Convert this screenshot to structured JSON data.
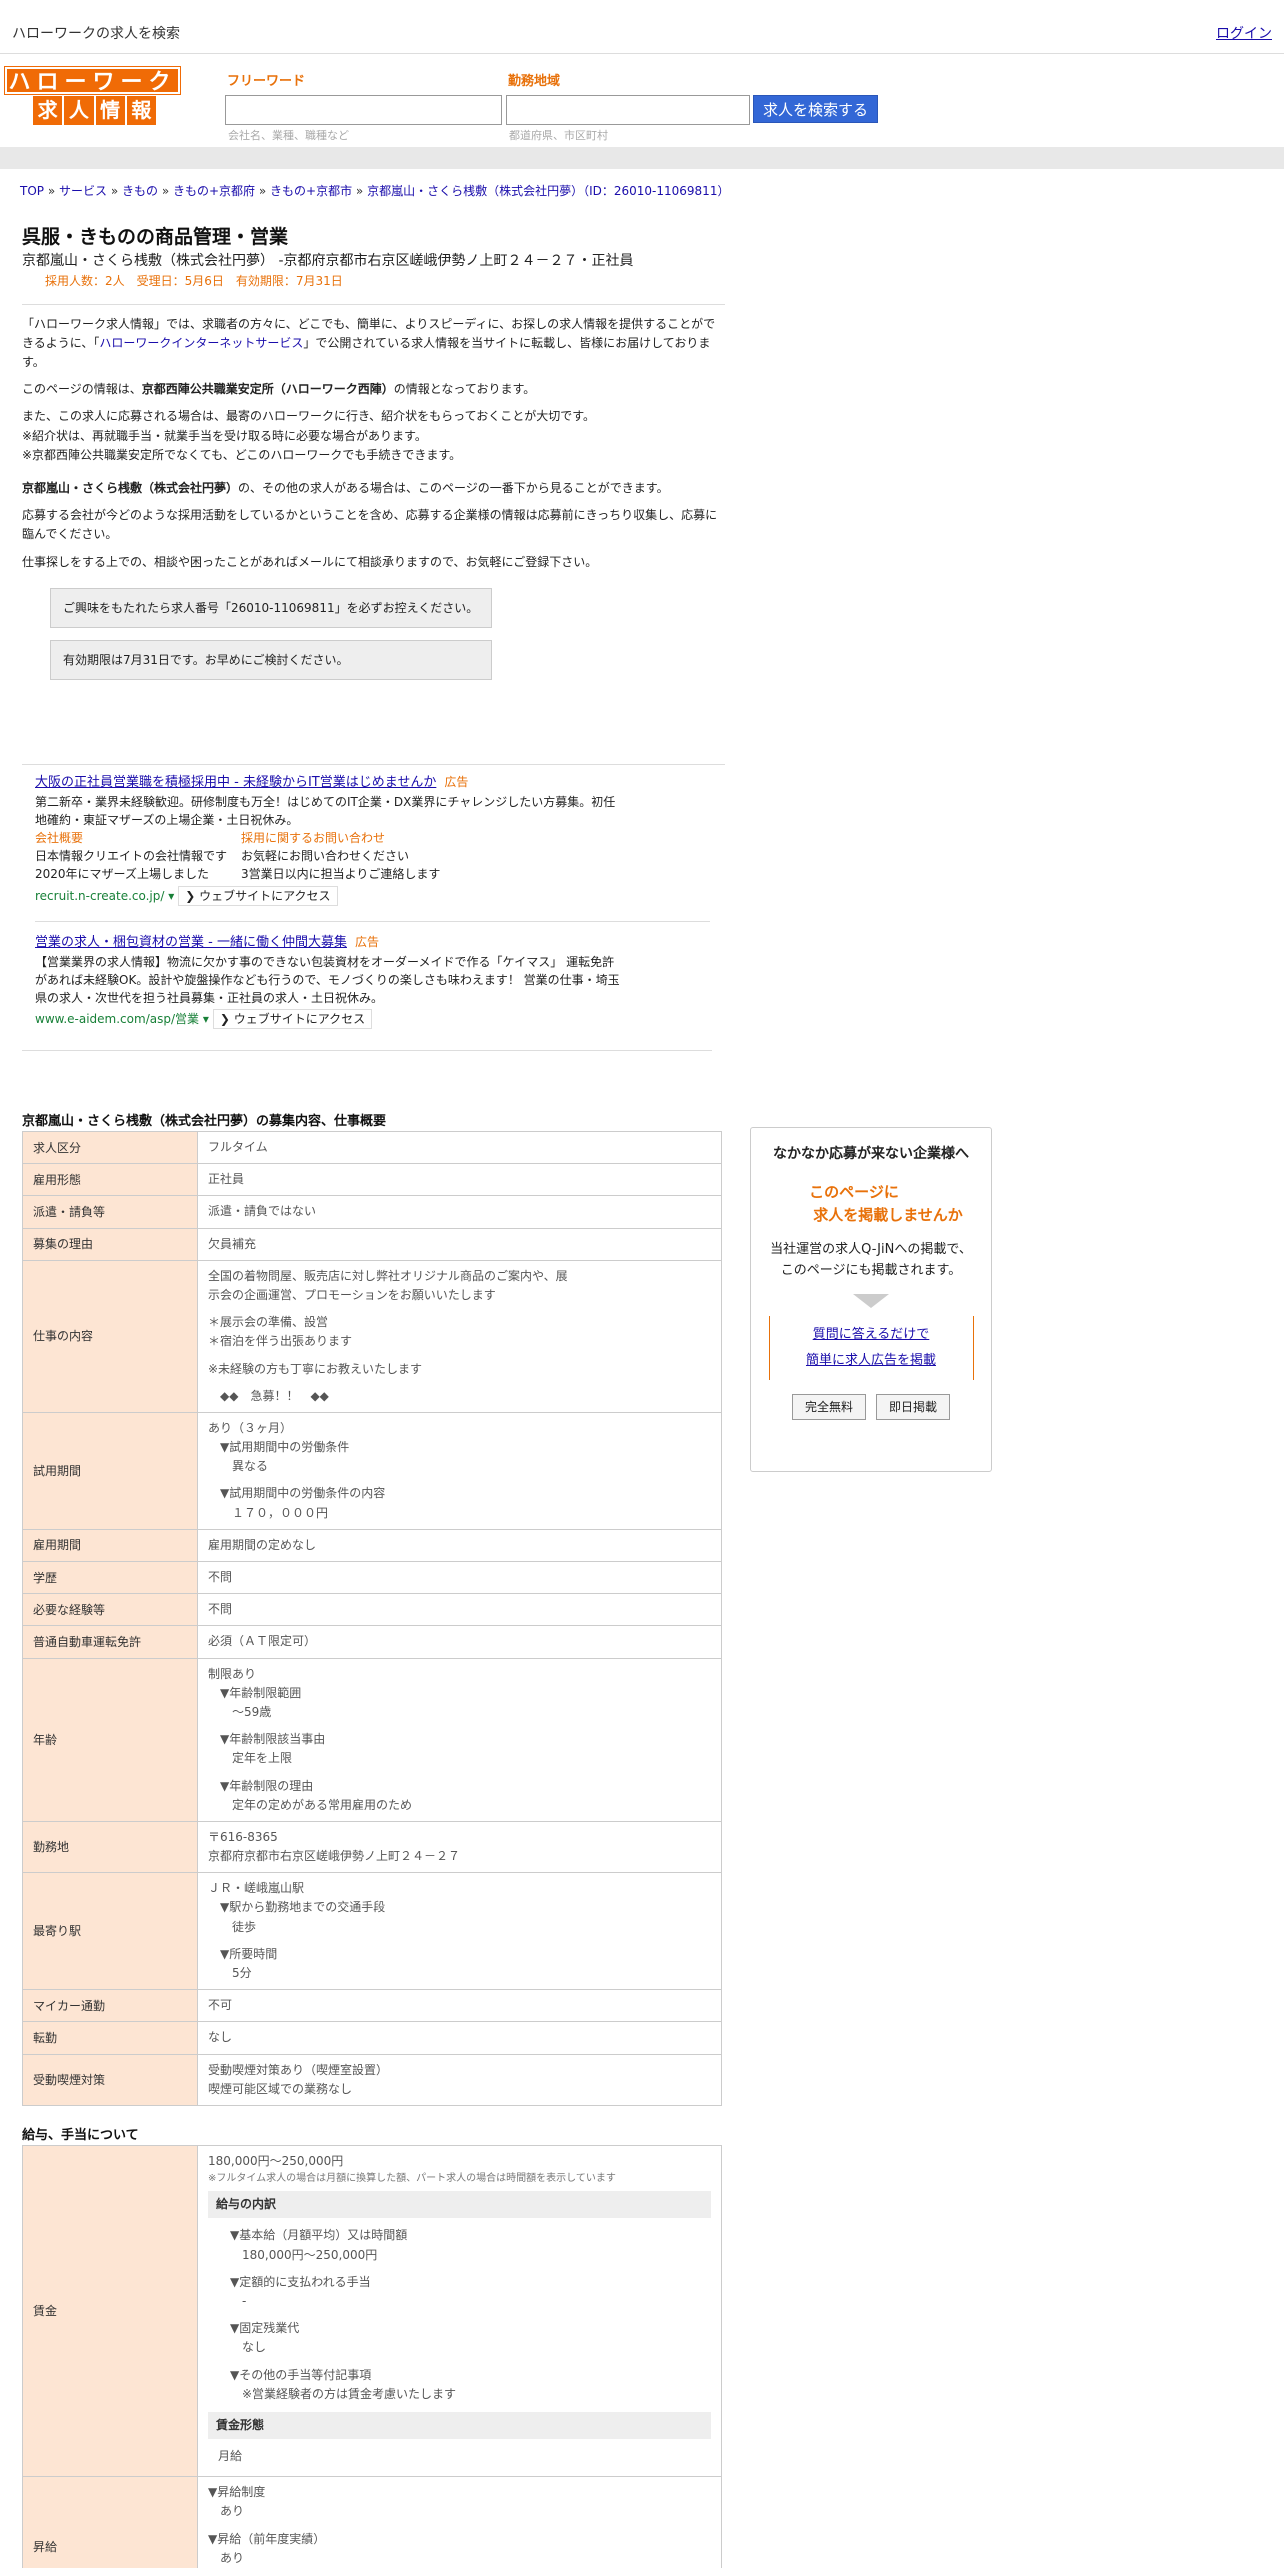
{
  "topbar": {
    "title": "ハローワークの求人を検索",
    "login": "ログイン"
  },
  "logo": {
    "row1": "ハローワーク",
    "row2": [
      "求",
      "人",
      "情",
      "報"
    ]
  },
  "search": {
    "free_label": "フリーワード",
    "free_hint": "会社名、業種、職種など",
    "area_label": "勤務地域",
    "area_hint": "都道府県、市区町村",
    "button": "求人を検索する"
  },
  "breadcrumb": [
    "TOP",
    "サービス",
    "きもの",
    "きもの+京都府",
    "きもの+京都市",
    "京都嵐山・さくら桟敷（株式会社円夢）（ID：26010-11069811）"
  ],
  "job": {
    "title": "呉服・きものの商品管理・営業",
    "subtitle": "京都嵐山・さくら桟敷（株式会社円夢） -京都府京都市右京区嵯峨伊勢ノ上町２４－２７・正社員",
    "meta": "採用人数：2人　受理日：5月6日　有効期限：7月31日"
  },
  "intro": {
    "p1a": "「ハローワーク求人情報」では、求職者の方々に、どこでも、簡単に、よりスピーディに、お探しの求人情報を提供することができるように、「",
    "p1link": "ハローワークインターネットサービス",
    "p1b": "」で公開されている求人情報を当サイトに転載し、皆様にお届けしております。",
    "p2a": "このページの情報は、",
    "p2b": "京都西陣公共職業安定所（ハローワーク西陣）",
    "p2c": "の情報となっております。",
    "p3": "また、この求人に応募される場合は、最寄のハローワークに行き、紹介状をもらっておくことが大切です。",
    "p4": "※紹介状は、再就職手当・就業手当を受け取る時に必要な場合があります。",
    "p5": "※京都西陣公共職業安定所でなくても、どこのハローワークでも手続きできます。",
    "p6a": "京都嵐山・さくら桟敷（株式会社円夢）",
    "p6b": "の、その他の求人がある場合は、このページの一番下から見ることができます。",
    "p7": "応募する会社が今どのような採用活動をしているかということを含め、応募する企業様の情報は応募前にきっちり収集し、応募に臨んでください。",
    "p8": "仕事探しをする上での、相談や困ったことがあればメールにて相談承りますので、お気軽にご登録下さい。",
    "note1": "ご興味をもたれたら求人番号「26010-11069811」を必ずお控えください。",
    "note2": "有効期限は7月31日です。お早めにご検討ください。"
  },
  "ads": [
    {
      "title": "大阪の正社員営業職を積極採用中 - 未経験からIT営業はじめませんか",
      "tag": "広告",
      "desc": "第二新卒・業界未経験歓迎。研修制度も万全！はじめてのIT企業・DX業界にチャレンジしたい方募集。初任地確約・東証マザーズの上場企業・土日祝休み。",
      "c1h": "会社概要",
      "c1a": "日本情報クリエイトの会社情報です",
      "c1b": "2020年にマザーズ上場しました",
      "c2h": "採用に関するお問い合わせ",
      "c2a": "お気軽にお問い合わせください",
      "c2b": "3営業日以内に担当よりご連絡します",
      "url": "recruit.n-create.co.jp/",
      "visit": "❯ ウェブサイトにアクセス"
    },
    {
      "title": "営業の求人・梱包資材の営業 - 一緒に働く仲間大募集",
      "tag": "広告",
      "desc": "【営業業界の求人情報】物流に欠かす事のできない包装資材をオーダーメイドで作る「ケイマス」 運転免許があれば未経験OK。設計や旋盤操作なども行うので、モノづくりの楽しさも味わえます！ 営業の仕事・埼玉県の求人・次世代を担う社員募集・正社員の求人・土日祝休み。",
      "url": "www.e-aidem.com/asp/営業",
      "visit": "❯ ウェブサイトにアクセス"
    }
  ],
  "section1": "京都嵐山・さくら桟敷（株式会社円夢）の募集内容、仕事概要",
  "rows": [
    {
      "h": "求人区分",
      "v": [
        "フルタイム"
      ]
    },
    {
      "h": "雇用形態",
      "v": [
        "正社員"
      ]
    },
    {
      "h": "派遣・請負等",
      "v": [
        "派遣・請負ではない"
      ]
    },
    {
      "h": "募集の理由",
      "v": [
        "欠員補充"
      ]
    },
    {
      "h": "仕事の内容",
      "v": [
        "全国の着物問屋、販売店に対し弊社オリジナル商品のご案内や、展",
        "示会の企画運営、プロモーションをお願いいたします",
        "",
        "＊展示会の準備、設営",
        "＊宿泊を伴う出張あります",
        "",
        "※未経験の方も丁寧にお教えいたします",
        "",
        "　◆◆　急募！！　◆◆"
      ]
    },
    {
      "h": "試用期間",
      "v": [
        "あり（３ヶ月）",
        "　▼試用期間中の労働条件",
        "　　異なる",
        "",
        "　▼試用期間中の労働条件の内容",
        "　　１７０，０００円"
      ]
    },
    {
      "h": "雇用期間",
      "v": [
        "雇用期間の定めなし"
      ]
    },
    {
      "h": "学歴",
      "v": [
        "不問"
      ]
    },
    {
      "h": "必要な経験等",
      "v": [
        "不問"
      ]
    },
    {
      "h": "普通自動車運転免許",
      "v": [
        "必須（ＡＴ限定可）"
      ]
    },
    {
      "h": "年齢",
      "v": [
        "制限あり",
        "　▼年齢制限範囲",
        "　　〜59歳",
        "",
        "　▼年齢制限該当事由",
        "　　定年を上限",
        "",
        "　▼年齢制限の理由",
        "　　定年の定めがある常用雇用のため"
      ]
    },
    {
      "h": "勤務地",
      "v": [
        "〒616-8365",
        "京都府京都市右京区嵯峨伊勢ノ上町２４－２７"
      ]
    },
    {
      "h": "最寄り駅",
      "v": [
        "ＪＲ・嵯峨嵐山駅",
        "　▼駅から勤務地までの交通手段",
        "　　徒歩",
        "",
        "　▼所要時間",
        "　　5分"
      ]
    },
    {
      "h": "マイカー通勤",
      "v": [
        "不可"
      ]
    },
    {
      "h": "転勤",
      "v": [
        "なし"
      ]
    },
    {
      "h": "受動喫煙対策",
      "v": [
        "受動喫煙対策あり（喫煙室設置）",
        "喫煙可能区域での業務なし"
      ]
    }
  ],
  "section2": "給与、手当について",
  "wage": {
    "h": "賃金",
    "range": "180,000円〜250,000円",
    "note": "※フルタイム求人の場合は月額に換算した額、パート求人の場合は時間額を表示しています",
    "box1": "給与の内訳",
    "items": [
      "　▼基本給（月額平均）又は時間額",
      "　　180,000円〜250,000円",
      "",
      "　▼定額的に支払われる手当",
      "　　-",
      "",
      "　▼固定残業代",
      "　　なし",
      "",
      "　▼その他の手当等付記事項",
      "　　※営業経験者の方は賃金考慮いたします"
    ],
    "box2": "賃金形態",
    "form": "月給"
  },
  "raise": {
    "h": "昇給",
    "v": [
      "▼昇給制度",
      "　あり",
      "",
      "▼昇給（前年度実績）",
      "　あり"
    ]
  },
  "side": {
    "t1": "なかなか応募が来ない企業様へ",
    "t2a": "このページに",
    "t2b": "求人を掲載しませんか",
    "t3a": "当社運営の求人Q-JiNへの掲載で、",
    "t3b": "このページにも掲載されます。",
    "link1": "質問に答えるだけで",
    "link2": "簡単に求人広告を掲載",
    "btn1": "完全無料",
    "btn2": "即日掲載"
  }
}
